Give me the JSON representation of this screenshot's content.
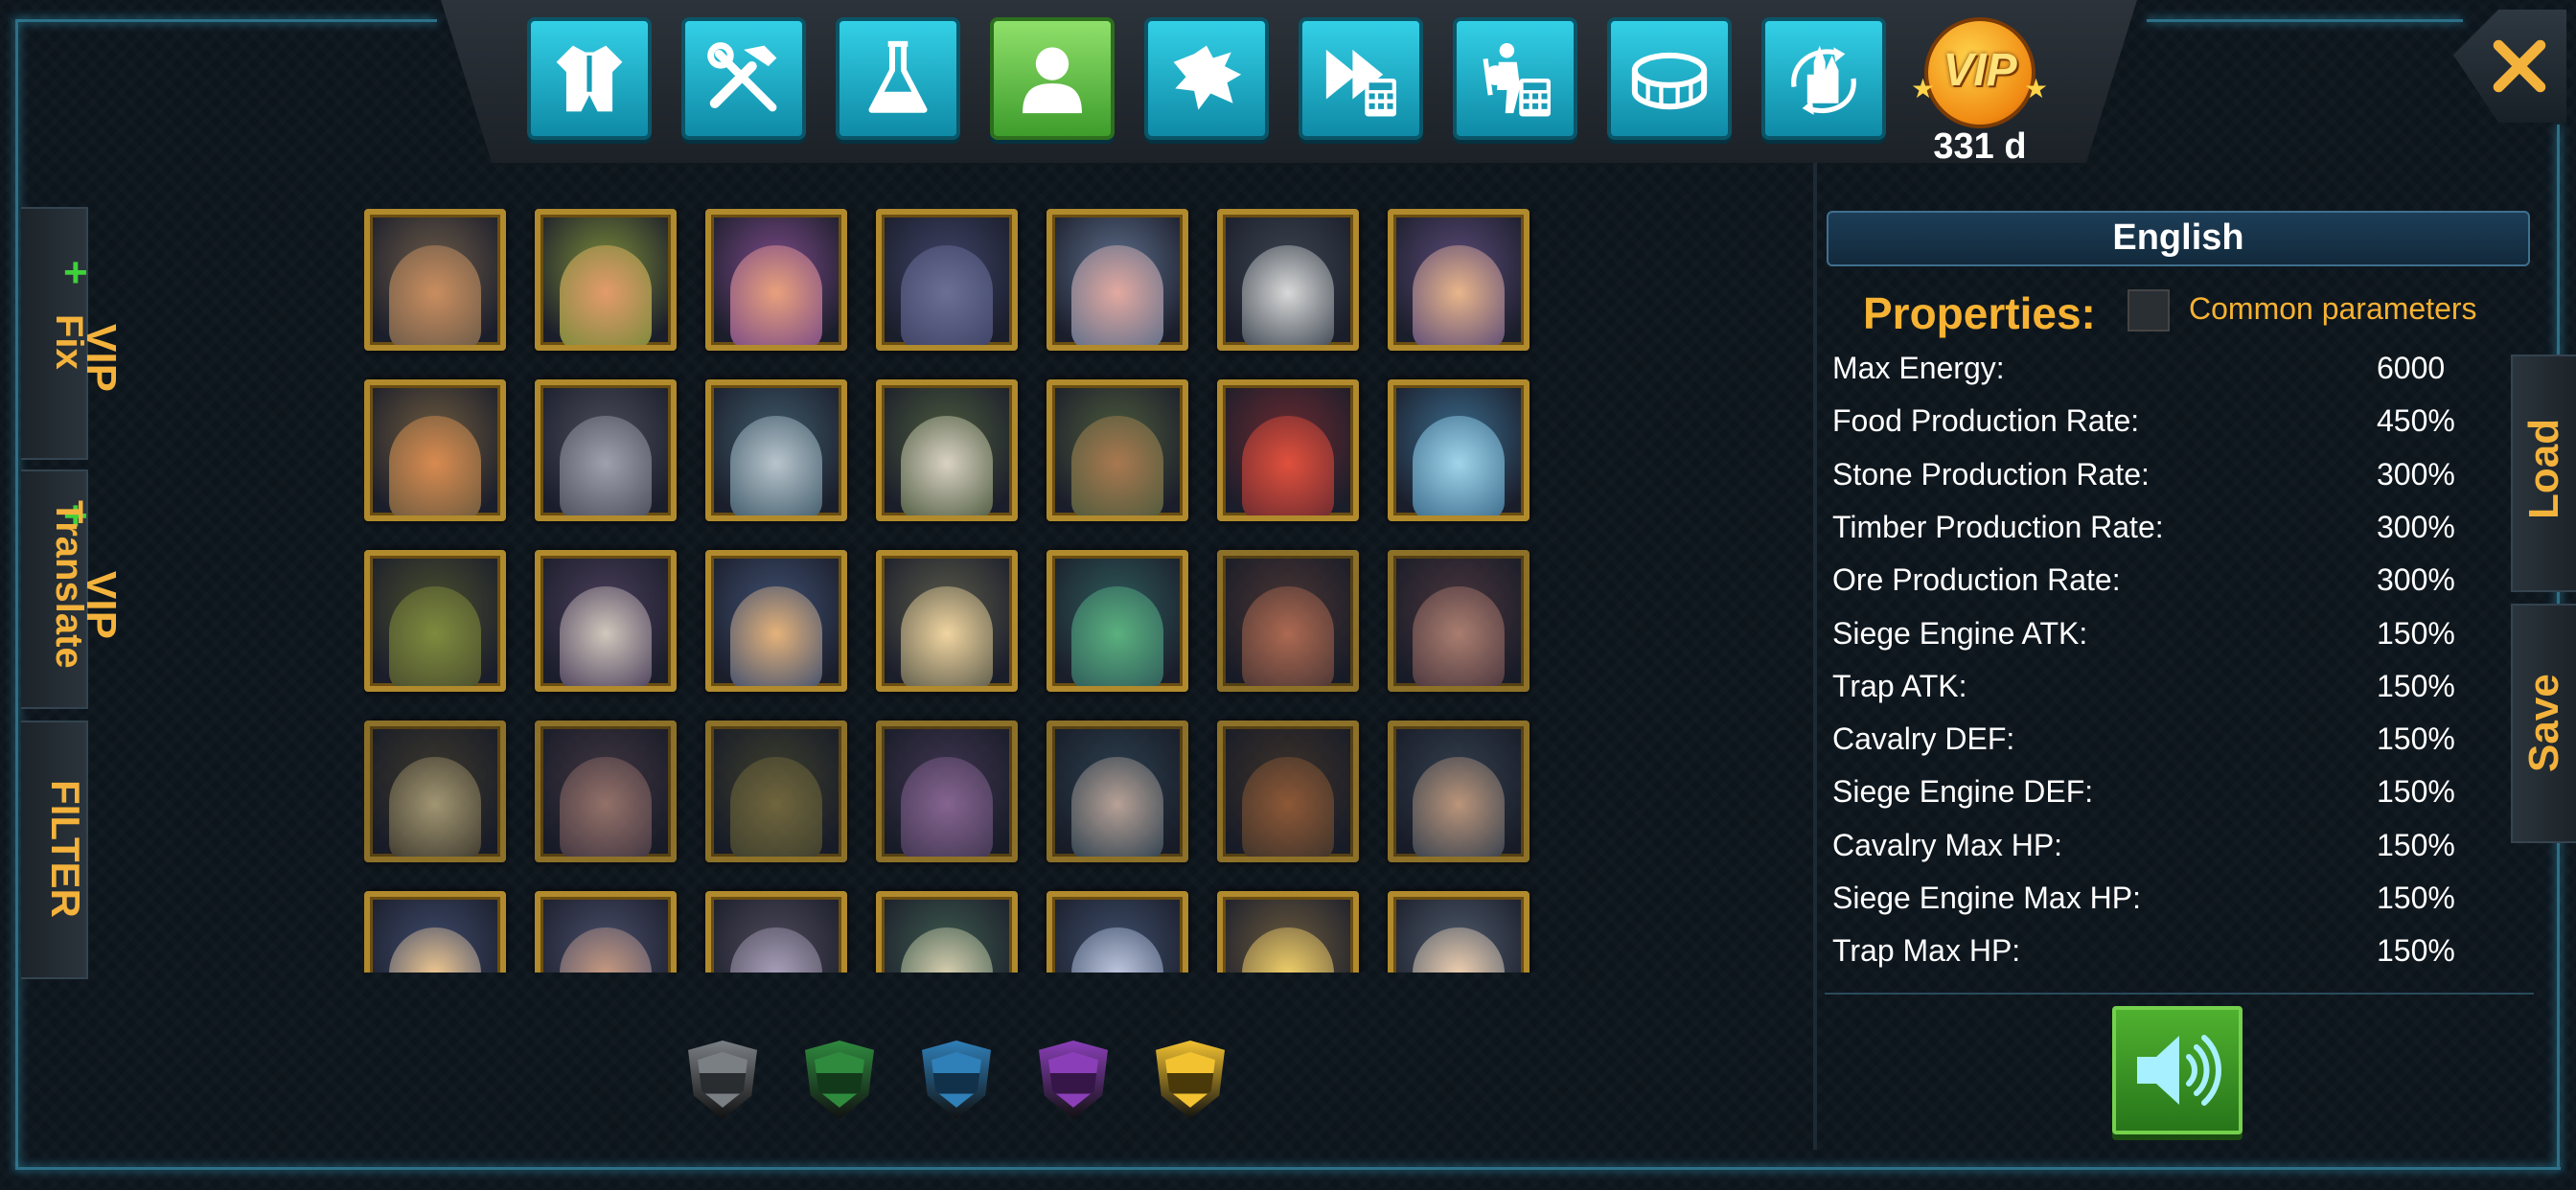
{
  "nav": {
    "buttons": [
      {
        "icon": "armor-icon",
        "active": false
      },
      {
        "icon": "tools-icon",
        "active": false
      },
      {
        "icon": "flask-icon",
        "active": false
      },
      {
        "icon": "person-icon",
        "active": true
      },
      {
        "icon": "dragon-icon",
        "active": false
      },
      {
        "icon": "fast-forward-calculator-icon",
        "active": false
      },
      {
        "icon": "warrior-calculator-icon",
        "active": false
      },
      {
        "icon": "arena-icon",
        "active": false
      },
      {
        "icon": "castle-refresh-icon",
        "active": false
      }
    ],
    "vip_label": "VIP",
    "vip_days": "331 d",
    "close_icon": "close-icon"
  },
  "left_tabs": {
    "vip_fix": {
      "vip": "VIP",
      "label": "Fix",
      "plus": "+"
    },
    "vip_translate": {
      "vip": "VIP",
      "label": "Translate",
      "plus": "+"
    },
    "filter": "FILTER"
  },
  "heroes": {
    "rows": [
      [
        {
          "bg": "#6b5a48",
          "face": "#c98d5f"
        },
        {
          "bg": "#7a8a3a",
          "face": "#e39a6c"
        },
        {
          "bg": "#7a4a86",
          "face": "#e8a07c"
        },
        {
          "bg": "#3e4366",
          "face": "#6a6f93"
        },
        {
          "bg": "#5d6e8a",
          "face": "#e2a9a0"
        },
        {
          "bg": "#3c4550",
          "face": "#d8d8d8"
        },
        {
          "bg": "#5a4a76",
          "face": "#e8b58a"
        }
      ],
      [
        {
          "bg": "#6d5a3e",
          "face": "#d88a50"
        },
        {
          "bg": "#4b4e5a",
          "face": "#9ea1ad"
        },
        {
          "bg": "#3f5a6a",
          "face": "#b8c4cc"
        },
        {
          "bg": "#4c5a3e",
          "face": "#d9d2c4"
        },
        {
          "bg": "#4d5a3c",
          "face": "#a87850"
        },
        {
          "bg": "#6a2a30",
          "face": "#e0503c"
        },
        {
          "bg": "#3a6a8a",
          "face": "#9fd4ea"
        }
      ],
      [
        {
          "bg": "#4a4e2e",
          "face": "#7e8a3e"
        },
        {
          "bg": "#4a3e5a",
          "face": "#d0c7bc"
        },
        {
          "bg": "#3e4e6e",
          "face": "#e4b27a"
        },
        {
          "bg": "#5a5a4a",
          "face": "#f0d4a0"
        },
        {
          "bg": "#2e5a5a",
          "face": "#5ab07e"
        },
        {
          "bg": "#5a3e3a",
          "face": "#d88060"
        },
        {
          "bg": "#5a3e46",
          "face": "#d49a86"
        }
      ],
      [
        {
          "bg": "#4a4232",
          "face": "#cab98a"
        },
        {
          "bg": "#4e3e4a",
          "face": "#b88a7e"
        },
        {
          "bg": "#4a4a32",
          "face": "#8a7a46"
        },
        {
          "bg": "#4e3e5e",
          "face": "#a67ab0"
        },
        {
          "bg": "#344a5a",
          "face": "#e6c8b8"
        },
        {
          "bg": "#4a3a2e",
          "face": "#b06a3e"
        },
        {
          "bg": "#3e4a5a",
          "face": "#eab894"
        }
      ],
      [
        {
          "bg": "#3e4a6a",
          "face": "#f0c890"
        },
        {
          "bg": "#4a4e6a",
          "face": "#c89a80"
        },
        {
          "bg": "#4e4a5a",
          "face": "#a8a0ba"
        },
        {
          "bg": "#3e5a4e",
          "face": "#d8d0b0"
        },
        {
          "bg": "#3e4e6a",
          "face": "#c0c8e0"
        },
        {
          "bg": "#6a5a3e",
          "face": "#f0d06a"
        },
        {
          "bg": "#4e5a6a",
          "face": "#f0d0b0"
        }
      ]
    ]
  },
  "rarity_shields": [
    {
      "name": "gray",
      "color": "#7a7f84",
      "inner": "#2a2d30"
    },
    {
      "name": "green",
      "color": "#2f8a3e",
      "inner": "#123a1a"
    },
    {
      "name": "blue",
      "color": "#2f7fb8",
      "inner": "#11304a"
    },
    {
      "name": "purple",
      "color": "#8a3fb8",
      "inner": "#361648"
    },
    {
      "name": "gold",
      "color": "#f2c230",
      "inner": "#4a3a0a"
    }
  ],
  "panel": {
    "language": "English",
    "properties_title": "Properties:",
    "common_parameters": "Common parameters",
    "properties": [
      {
        "name": "Max Energy:",
        "value": "6000"
      },
      {
        "name": "Food Production Rate:",
        "value": "450%"
      },
      {
        "name": "Stone Production Rate:",
        "value": "300%"
      },
      {
        "name": "Timber Production Rate:",
        "value": "300%"
      },
      {
        "name": "Ore Production Rate:",
        "value": "300%"
      },
      {
        "name": "Siege Engine ATK:",
        "value": "150%"
      },
      {
        "name": "Trap ATK:",
        "value": "150%"
      },
      {
        "name": "Cavalry DEF:",
        "value": "150%"
      },
      {
        "name": "Siege Engine DEF:",
        "value": "150%"
      },
      {
        "name": "Cavalry Max HP:",
        "value": "150%"
      },
      {
        "name": "Siege Engine Max HP:",
        "value": "150%"
      },
      {
        "name": "Trap Max HP:",
        "value": "150%"
      }
    ],
    "sound_icon": "speaker-icon"
  },
  "right_tabs": {
    "load": "Load",
    "save": "Save"
  }
}
